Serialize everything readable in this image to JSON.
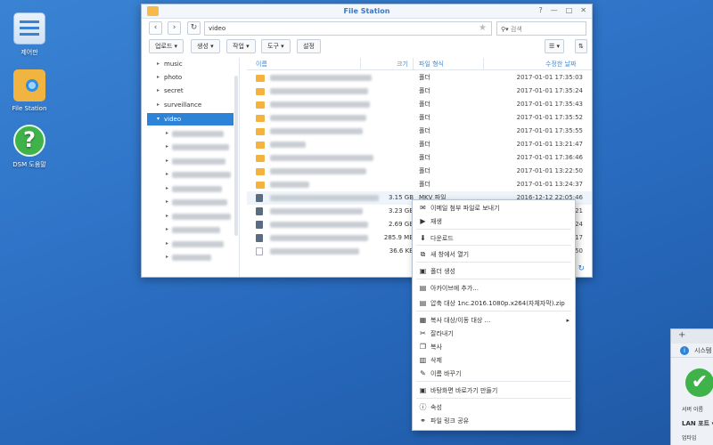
{
  "desktop": {
    "icons": [
      {
        "label": "제어판",
        "icon": "control-panel-icon"
      },
      {
        "label": "File Station",
        "icon": "folder-search-icon"
      },
      {
        "label": "DSM 도움말",
        "icon": "help-icon"
      }
    ]
  },
  "window": {
    "title": "File Station",
    "controls": [
      "?",
      "—",
      "□",
      "✕"
    ],
    "path": "video",
    "search_placeholder": "검색",
    "toolbar": {
      "upload": "업로드 ▾",
      "create": "생성 ▾",
      "action": "작업 ▾",
      "tools": "도구 ▾",
      "settings": "설정"
    },
    "tree": {
      "items": [
        {
          "label": "music"
        },
        {
          "label": "photo"
        },
        {
          "label": "secret"
        },
        {
          "label": "surveillance"
        },
        {
          "label": "video",
          "selected": true
        }
      ]
    },
    "columns": {
      "name": "이름",
      "size": "크기",
      "type": "파일 형식",
      "modified": "수정한 날짜"
    },
    "files": [
      {
        "kind": "folder",
        "size": "",
        "type": "폴더",
        "modified": "2017-01-01 17:35:03"
      },
      {
        "kind": "folder",
        "size": "",
        "type": "폴더",
        "modified": "2017-01-01 17:35:24"
      },
      {
        "kind": "folder",
        "size": "",
        "type": "폴더",
        "modified": "2017-01-01 17:35:43"
      },
      {
        "kind": "folder",
        "size": "",
        "type": "폴더",
        "modified": "2017-01-01 17:35:52"
      },
      {
        "kind": "folder",
        "size": "",
        "type": "폴더",
        "modified": "2017-01-01 17:35:55"
      },
      {
        "kind": "folder",
        "size": "",
        "type": "폴더",
        "modified": "2017-01-01 13:21:47"
      },
      {
        "kind": "folder",
        "size": "",
        "type": "폴더",
        "modified": "2017-01-01 17:36:46"
      },
      {
        "kind": "folder",
        "size": "",
        "type": "폴더",
        "modified": "2017-01-01 13:22:50"
      },
      {
        "kind": "folder",
        "size": "",
        "type": "폴더",
        "modified": "2017-01-01 13:24:37"
      },
      {
        "kind": "video",
        "size": "3.15 GB",
        "type": "MKV 파일",
        "modified": "2016-12-12 22:05:46"
      },
      {
        "kind": "video",
        "size": "3.23 GB",
        "type": "",
        "modified": "21"
      },
      {
        "kind": "video",
        "size": "2.69 GB",
        "type": "",
        "modified": "24"
      },
      {
        "kind": "video",
        "size": "285.9 MB",
        "type": "",
        "modified": "17"
      },
      {
        "kind": "doc",
        "size": "36.6 KB",
        "type": "",
        "modified": "50"
      }
    ]
  },
  "context_menu": {
    "items": [
      {
        "label": "이메일 첨부 파일로 보내기",
        "icon": "email-icon"
      },
      {
        "label": "재생",
        "icon": "play-icon"
      },
      {
        "label": "다운로드",
        "icon": "download-icon"
      },
      {
        "label": "새 창에서 열기",
        "icon": "new-window-icon"
      },
      {
        "label": "폴더 생성",
        "icon": "new-folder-icon"
      },
      {
        "label": "아카이브에 추가...",
        "icon": "archive-icon"
      },
      {
        "label": "압축 대상 1nc.2016.1080p.x264(자체자막).zip",
        "icon": "compress-icon"
      },
      {
        "label": "복사 대상/이동 대상 ...",
        "icon": "copy-move-icon",
        "submenu": "▸"
      },
      {
        "label": "잘라내기",
        "icon": "cut-icon"
      },
      {
        "label": "복사",
        "icon": "copy-icon"
      },
      {
        "label": "삭제",
        "icon": "delete-icon"
      },
      {
        "label": "이름 바꾸기",
        "icon": "rename-icon"
      },
      {
        "label": "바탕화면 바로가기 만들기",
        "icon": "shortcut-icon"
      },
      {
        "label": "속성",
        "icon": "info-icon"
      },
      {
        "label": "파일 링크 공유",
        "icon": "share-icon"
      }
    ]
  },
  "widget": {
    "title": "시스템",
    "server_name_label": "서버 이름",
    "lan_port_label": "LAN 포트",
    "uptime_label": "업타임"
  },
  "colors": {
    "accent": "#2c83d8",
    "folder": "#f3b33e",
    "desktop": "#2f74c8"
  }
}
